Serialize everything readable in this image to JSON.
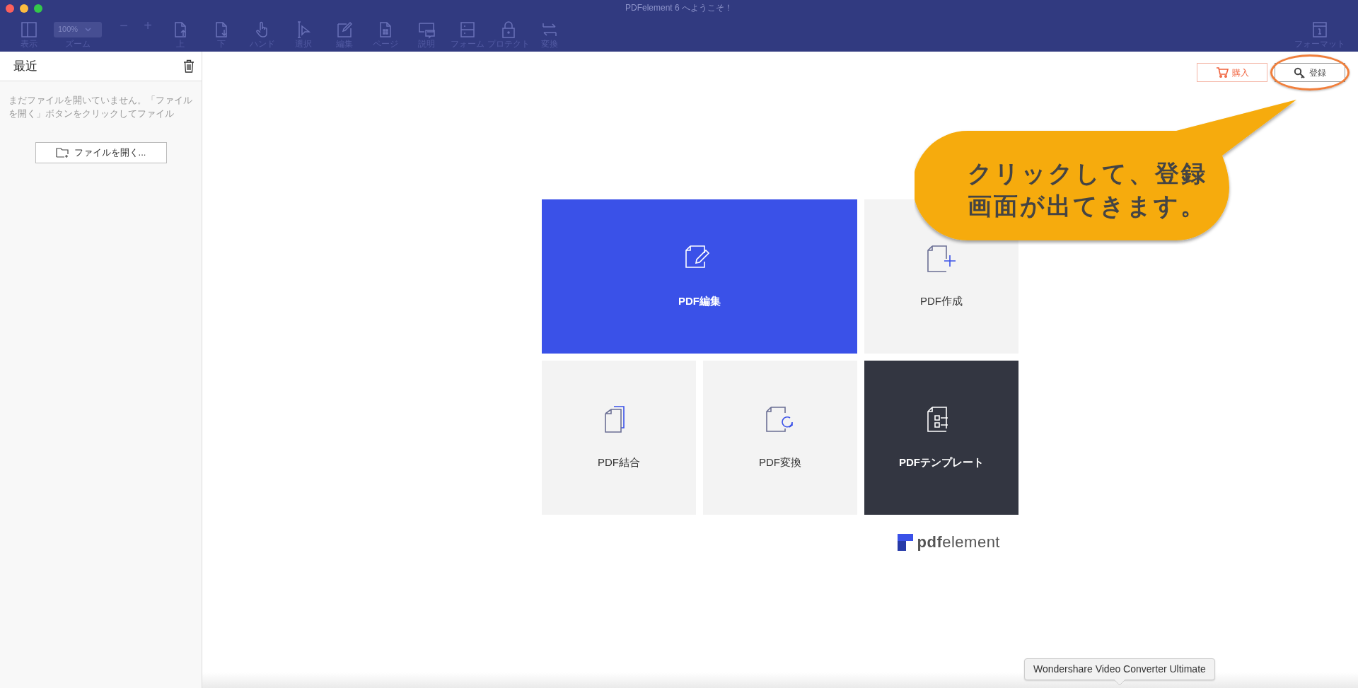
{
  "window": {
    "title": "PDFelement 6 へようこそ！"
  },
  "toolbar": {
    "items": [
      {
        "kind": "tool",
        "label": "表示"
      },
      {
        "kind": "zoom",
        "value": "100%",
        "label": "ズーム"
      },
      {
        "kind": "step",
        "label": "−"
      },
      {
        "kind": "step",
        "label": "+"
      },
      {
        "kind": "tool",
        "label": "上"
      },
      {
        "kind": "tool",
        "label": "下"
      },
      {
        "kind": "tool",
        "label": "ハンド"
      },
      {
        "kind": "tool",
        "label": "選択"
      },
      {
        "kind": "tool",
        "label": "編集"
      },
      {
        "kind": "tool",
        "label": "ページ"
      },
      {
        "kind": "tool",
        "label": "説明"
      },
      {
        "kind": "tool",
        "label": "フォーム"
      },
      {
        "kind": "tool",
        "label": "プロテクト"
      },
      {
        "kind": "tool",
        "label": "変換"
      }
    ],
    "right": {
      "label": "フォーマット"
    }
  },
  "sidebar": {
    "title": "最近",
    "empty_text": "まだファイルを開いていません。「ファイルを開く」ボタンをクリックしてファイル",
    "open_button": "ファイルを開く..."
  },
  "header_buttons": [
    {
      "kind": "buy",
      "label": "購入",
      "highlighted": false
    },
    {
      "kind": "register",
      "label": "登録",
      "highlighted": true
    }
  ],
  "callout": {
    "lines": [
      "クリックして、登録",
      "画面が出てきます。"
    ]
  },
  "tiles": [
    {
      "kind": "edit",
      "label": "PDF編集",
      "color": "#3a51e8"
    },
    {
      "kind": "create",
      "label": "PDF作成",
      "color": "#f3f3f3"
    },
    {
      "kind": "combine",
      "label": "PDF結合",
      "color": "#f3f3f3"
    },
    {
      "kind": "convert",
      "label": "PDF変換",
      "color": "#f3f3f3"
    },
    {
      "kind": "template",
      "label": "PDFテンプレート",
      "color": "#333641"
    }
  ],
  "logo": {
    "text": "**pdf**element"
  },
  "tooltip": {
    "text": "Wondershare Video Converter Ultimate"
  }
}
